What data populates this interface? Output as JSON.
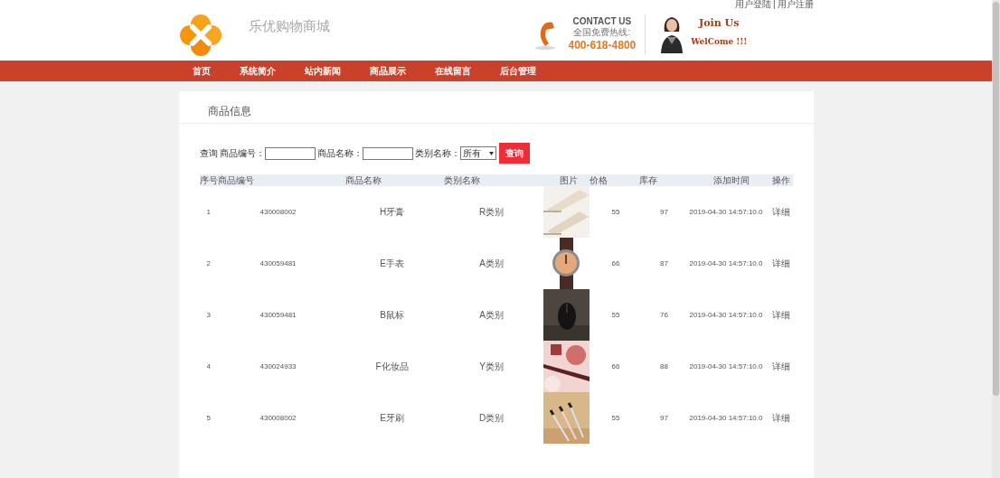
{
  "header": {
    "user_links": [
      "用户登陆",
      "用户注册"
    ],
    "separator": "|",
    "site_title": "乐优购物商城",
    "contact": {
      "heading": "CONTACT US",
      "hotline_label": "全国免费热线:",
      "phone": "400-618-4800"
    },
    "join": {
      "title": "Join Us",
      "welcome": "WelCome !!!"
    }
  },
  "nav": [
    "首页",
    "系统简介",
    "站内新闻",
    "商品展示",
    "在线留言",
    "后台管理"
  ],
  "panel": {
    "title": "商品信息",
    "search": {
      "prefix": "查询",
      "fields": [
        {
          "kind": "text",
          "label": "商品编号："
        },
        {
          "kind": "text",
          "label": "商品名称："
        },
        {
          "kind": "select",
          "label": "类别名称：",
          "value": "所有"
        }
      ],
      "button": "查询"
    },
    "table": {
      "columns": [
        "序号",
        "商品编号",
        "商品名称",
        "类别名称",
        "图片",
        "价格",
        "库存",
        "添加时间",
        "操作"
      ],
      "rows": [
        {
          "index": "1",
          "code": "430008002",
          "name": "H牙膏",
          "category": "R类别",
          "price": "55",
          "stock": "97",
          "added": "2019-04-30 14:57:10.0",
          "action": "详细"
        },
        {
          "index": "2",
          "code": "430059481",
          "name": "E手表",
          "category": "A类别",
          "price": "66",
          "stock": "87",
          "added": "2019-04-30 14:57:10.0",
          "action": "详细"
        },
        {
          "index": "3",
          "code": "430059481",
          "name": "B鼠标",
          "category": "A类别",
          "price": "55",
          "stock": "76",
          "added": "2019-04-30 14:57:10.0",
          "action": "详细"
        },
        {
          "index": "4",
          "code": "430024933",
          "name": "F化妆品",
          "category": "Y类别",
          "price": "66",
          "stock": "88",
          "added": "2019-04-30 14:57:10.0",
          "action": "详细"
        },
        {
          "index": "5",
          "code": "430008002",
          "name": "E牙刷",
          "category": "D类别",
          "price": "55",
          "stock": "97",
          "added": "2019-04-30 14:57:10.0",
          "action": "详细"
        }
      ]
    }
  }
}
